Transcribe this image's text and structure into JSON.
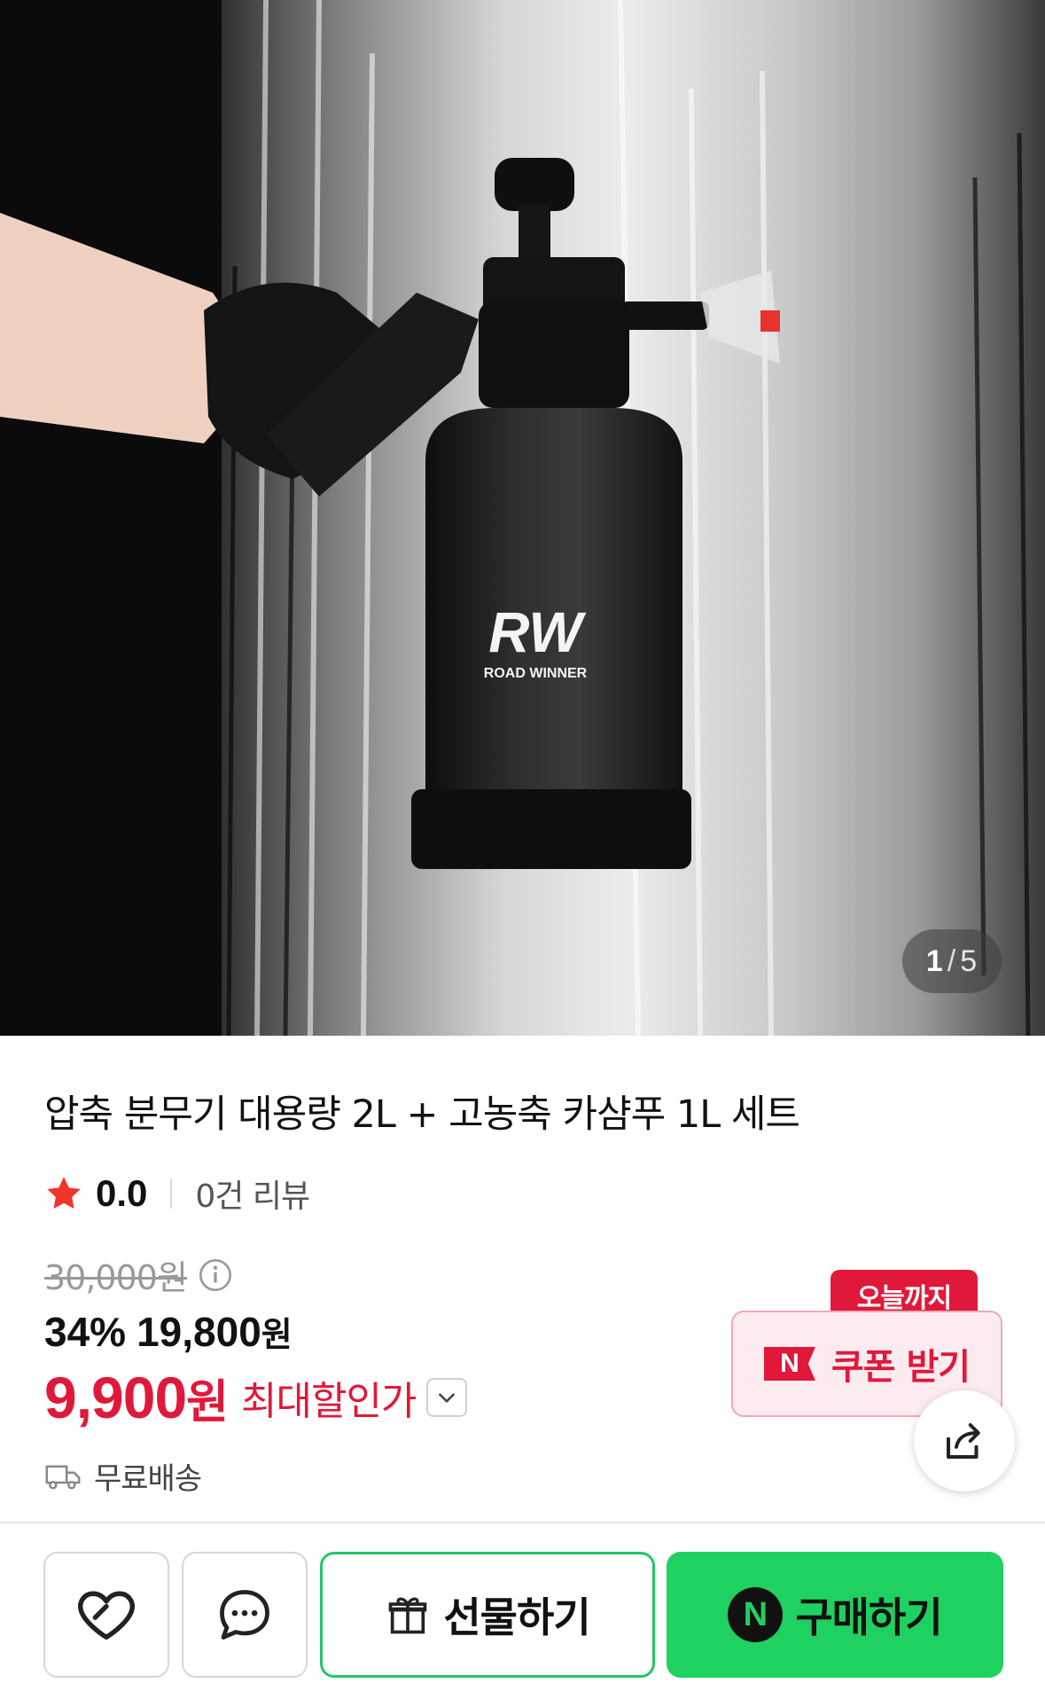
{
  "gallery": {
    "current": "1",
    "separator": "/",
    "total": "5",
    "logo_text": "RW",
    "brand_text": "ROAD WINNER"
  },
  "product": {
    "title": "압축 분무기 대용량 2L + 고농축 카샴푸 1L 세트",
    "rating": "0.0",
    "review_count": "0건 리뷰",
    "original_price": "30,000원",
    "discount_percent": "34%",
    "discount_price": "19,800",
    "discount_won": "원",
    "max_price": "9,900",
    "max_won": "원",
    "max_discount_label": "최대할인가",
    "shipping": "무료배송"
  },
  "coupon": {
    "tag": "오늘까지",
    "badge": "N",
    "label": "쿠폰 받기"
  },
  "actions": {
    "gift_label": "선물하기",
    "buy_badge": "N",
    "buy_label": "구매하기"
  },
  "colors": {
    "accent_red": "#e0193a",
    "naver_green": "#1fd160"
  },
  "icons": [
    "star-icon",
    "info-icon",
    "chevron-down-icon",
    "truck-icon",
    "share-icon",
    "heart-icon",
    "chat-icon",
    "gift-icon"
  ]
}
